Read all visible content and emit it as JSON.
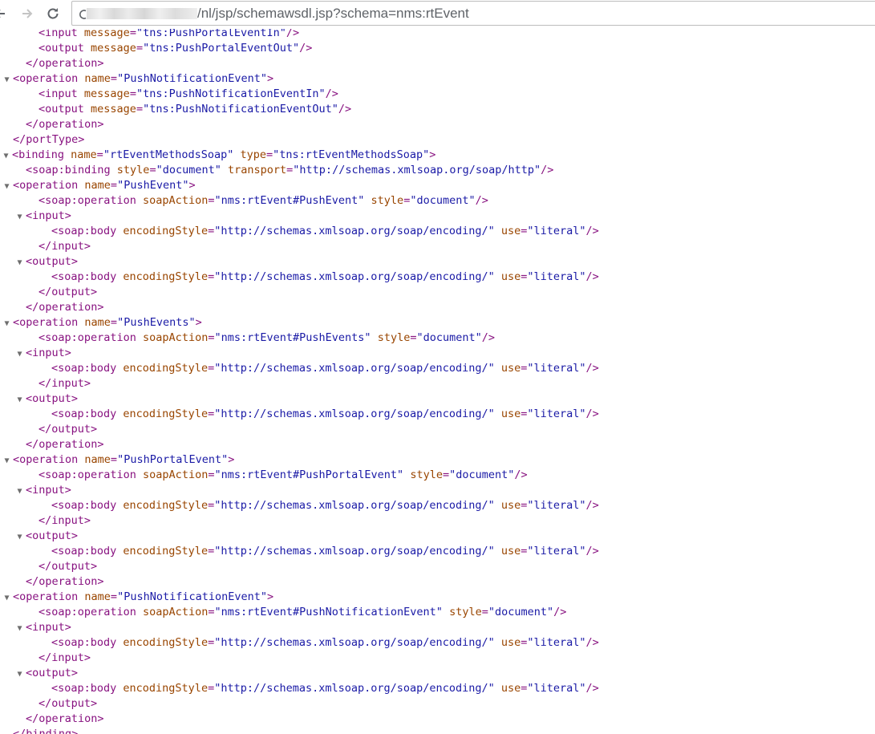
{
  "browser": {
    "url_path": "/nl/jsp/schemawsdl.jsp?schema=nms:rtEvent",
    "icons": {
      "back": "back-arrow-icon",
      "forward": "forward-arrow-icon",
      "reload": "reload-icon",
      "site": "info-icon"
    }
  },
  "colors": {
    "tag": "#881280",
    "attribute": "#994500",
    "value": "#1a1aa6",
    "toggle": "#6e6e6e"
  },
  "xml_lines": [
    {
      "indent": 3,
      "toggle": "",
      "parts": [
        [
          "t",
          "<input "
        ],
        [
          "a",
          "message"
        ],
        [
          "t",
          "="
        ],
        [
          "v",
          "\"tns:PushPortalEventIn\""
        ],
        [
          "t",
          "/>"
        ]
      ]
    },
    {
      "indent": 3,
      "toggle": "",
      "parts": [
        [
          "t",
          "<output "
        ],
        [
          "a",
          "message"
        ],
        [
          "t",
          "="
        ],
        [
          "v",
          "\"tns:PushPortalEventOut\""
        ],
        [
          "t",
          "/>"
        ]
      ]
    },
    {
      "indent": 2,
      "toggle": "",
      "parts": [
        [
          "t",
          "</operation>"
        ]
      ]
    },
    {
      "indent": 1,
      "toggle": "▼",
      "parts": [
        [
          "t",
          "<operation "
        ],
        [
          "a",
          "name"
        ],
        [
          "t",
          "="
        ],
        [
          "v",
          "\"PushNotificationEvent\""
        ],
        [
          "t",
          ">"
        ]
      ]
    },
    {
      "indent": 3,
      "toggle": "",
      "parts": [
        [
          "t",
          "<input "
        ],
        [
          "a",
          "message"
        ],
        [
          "t",
          "="
        ],
        [
          "v",
          "\"tns:PushNotificationEventIn\""
        ],
        [
          "t",
          "/>"
        ]
      ]
    },
    {
      "indent": 3,
      "toggle": "",
      "parts": [
        [
          "t",
          "<output "
        ],
        [
          "a",
          "message"
        ],
        [
          "t",
          "="
        ],
        [
          "v",
          "\"tns:PushNotificationEventOut\""
        ],
        [
          "t",
          "/>"
        ]
      ]
    },
    {
      "indent": 2,
      "toggle": "",
      "parts": [
        [
          "t",
          "</operation>"
        ]
      ]
    },
    {
      "indent": 1,
      "toggle": "",
      "parts": [
        [
          "t",
          "</portType>"
        ]
      ]
    },
    {
      "indent": 0,
      "toggle": "▼",
      "parts": [
        [
          "t",
          "<binding "
        ],
        [
          "a",
          "name"
        ],
        [
          "t",
          "="
        ],
        [
          "v",
          "\"rtEventMethodsSoap\""
        ],
        [
          "t",
          " "
        ],
        [
          "a",
          "type"
        ],
        [
          "t",
          "="
        ],
        [
          "v",
          "\"tns:rtEventMethodsSoap\""
        ],
        [
          "t",
          ">"
        ]
      ]
    },
    {
      "indent": 2,
      "toggle": "",
      "parts": [
        [
          "t",
          "<soap:binding "
        ],
        [
          "a",
          "style"
        ],
        [
          "t",
          "="
        ],
        [
          "v",
          "\"document\""
        ],
        [
          "t",
          " "
        ],
        [
          "a",
          "transport"
        ],
        [
          "t",
          "="
        ],
        [
          "v",
          "\"http://schemas.xmlsoap.org/soap/http\""
        ],
        [
          "t",
          "/>"
        ]
      ]
    },
    {
      "indent": 1,
      "toggle": "▼",
      "parts": [
        [
          "t",
          "<operation "
        ],
        [
          "a",
          "name"
        ],
        [
          "t",
          "="
        ],
        [
          "v",
          "\"PushEvent\""
        ],
        [
          "t",
          ">"
        ]
      ]
    },
    {
      "indent": 3,
      "toggle": "",
      "parts": [
        [
          "t",
          "<soap:operation "
        ],
        [
          "a",
          "soapAction"
        ],
        [
          "t",
          "="
        ],
        [
          "v",
          "\"nms:rtEvent#PushEvent\""
        ],
        [
          "t",
          " "
        ],
        [
          "a",
          "style"
        ],
        [
          "t",
          "="
        ],
        [
          "v",
          "\"document\""
        ],
        [
          "t",
          "/>"
        ]
      ]
    },
    {
      "indent": 2,
      "toggle": "▼",
      "parts": [
        [
          "t",
          "<input>"
        ]
      ]
    },
    {
      "indent": 4,
      "toggle": "",
      "parts": [
        [
          "t",
          "<soap:body "
        ],
        [
          "a",
          "encodingStyle"
        ],
        [
          "t",
          "="
        ],
        [
          "v",
          "\"http://schemas.xmlsoap.org/soap/encoding/\""
        ],
        [
          "t",
          " "
        ],
        [
          "a",
          "use"
        ],
        [
          "t",
          "="
        ],
        [
          "v",
          "\"literal\""
        ],
        [
          "t",
          "/>"
        ]
      ]
    },
    {
      "indent": 3,
      "toggle": "",
      "parts": [
        [
          "t",
          "</input>"
        ]
      ]
    },
    {
      "indent": 2,
      "toggle": "▼",
      "parts": [
        [
          "t",
          "<output>"
        ]
      ]
    },
    {
      "indent": 4,
      "toggle": "",
      "parts": [
        [
          "t",
          "<soap:body "
        ],
        [
          "a",
          "encodingStyle"
        ],
        [
          "t",
          "="
        ],
        [
          "v",
          "\"http://schemas.xmlsoap.org/soap/encoding/\""
        ],
        [
          "t",
          " "
        ],
        [
          "a",
          "use"
        ],
        [
          "t",
          "="
        ],
        [
          "v",
          "\"literal\""
        ],
        [
          "t",
          "/>"
        ]
      ]
    },
    {
      "indent": 3,
      "toggle": "",
      "parts": [
        [
          "t",
          "</output>"
        ]
      ]
    },
    {
      "indent": 2,
      "toggle": "",
      "parts": [
        [
          "t",
          "</operation>"
        ]
      ]
    },
    {
      "indent": 1,
      "toggle": "▼",
      "parts": [
        [
          "t",
          "<operation "
        ],
        [
          "a",
          "name"
        ],
        [
          "t",
          "="
        ],
        [
          "v",
          "\"PushEvents\""
        ],
        [
          "t",
          ">"
        ]
      ]
    },
    {
      "indent": 3,
      "toggle": "",
      "parts": [
        [
          "t",
          "<soap:operation "
        ],
        [
          "a",
          "soapAction"
        ],
        [
          "t",
          "="
        ],
        [
          "v",
          "\"nms:rtEvent#PushEvents\""
        ],
        [
          "t",
          " "
        ],
        [
          "a",
          "style"
        ],
        [
          "t",
          "="
        ],
        [
          "v",
          "\"document\""
        ],
        [
          "t",
          "/>"
        ]
      ]
    },
    {
      "indent": 2,
      "toggle": "▼",
      "parts": [
        [
          "t",
          "<input>"
        ]
      ]
    },
    {
      "indent": 4,
      "toggle": "",
      "parts": [
        [
          "t",
          "<soap:body "
        ],
        [
          "a",
          "encodingStyle"
        ],
        [
          "t",
          "="
        ],
        [
          "v",
          "\"http://schemas.xmlsoap.org/soap/encoding/\""
        ],
        [
          "t",
          " "
        ],
        [
          "a",
          "use"
        ],
        [
          "t",
          "="
        ],
        [
          "v",
          "\"literal\""
        ],
        [
          "t",
          "/>"
        ]
      ]
    },
    {
      "indent": 3,
      "toggle": "",
      "parts": [
        [
          "t",
          "</input>"
        ]
      ]
    },
    {
      "indent": 2,
      "toggle": "▼",
      "parts": [
        [
          "t",
          "<output>"
        ]
      ]
    },
    {
      "indent": 4,
      "toggle": "",
      "parts": [
        [
          "t",
          "<soap:body "
        ],
        [
          "a",
          "encodingStyle"
        ],
        [
          "t",
          "="
        ],
        [
          "v",
          "\"http://schemas.xmlsoap.org/soap/encoding/\""
        ],
        [
          "t",
          " "
        ],
        [
          "a",
          "use"
        ],
        [
          "t",
          "="
        ],
        [
          "v",
          "\"literal\""
        ],
        [
          "t",
          "/>"
        ]
      ]
    },
    {
      "indent": 3,
      "toggle": "",
      "parts": [
        [
          "t",
          "</output>"
        ]
      ]
    },
    {
      "indent": 2,
      "toggle": "",
      "parts": [
        [
          "t",
          "</operation>"
        ]
      ]
    },
    {
      "indent": 1,
      "toggle": "▼",
      "parts": [
        [
          "t",
          "<operation "
        ],
        [
          "a",
          "name"
        ],
        [
          "t",
          "="
        ],
        [
          "v",
          "\"PushPortalEvent\""
        ],
        [
          "t",
          ">"
        ]
      ]
    },
    {
      "indent": 3,
      "toggle": "",
      "parts": [
        [
          "t",
          "<soap:operation "
        ],
        [
          "a",
          "soapAction"
        ],
        [
          "t",
          "="
        ],
        [
          "v",
          "\"nms:rtEvent#PushPortalEvent\""
        ],
        [
          "t",
          " "
        ],
        [
          "a",
          "style"
        ],
        [
          "t",
          "="
        ],
        [
          "v",
          "\"document\""
        ],
        [
          "t",
          "/>"
        ]
      ]
    },
    {
      "indent": 2,
      "toggle": "▼",
      "parts": [
        [
          "t",
          "<input>"
        ]
      ]
    },
    {
      "indent": 4,
      "toggle": "",
      "parts": [
        [
          "t",
          "<soap:body "
        ],
        [
          "a",
          "encodingStyle"
        ],
        [
          "t",
          "="
        ],
        [
          "v",
          "\"http://schemas.xmlsoap.org/soap/encoding/\""
        ],
        [
          "t",
          " "
        ],
        [
          "a",
          "use"
        ],
        [
          "t",
          "="
        ],
        [
          "v",
          "\"literal\""
        ],
        [
          "t",
          "/>"
        ]
      ]
    },
    {
      "indent": 3,
      "toggle": "",
      "parts": [
        [
          "t",
          "</input>"
        ]
      ]
    },
    {
      "indent": 2,
      "toggle": "▼",
      "parts": [
        [
          "t",
          "<output>"
        ]
      ]
    },
    {
      "indent": 4,
      "toggle": "",
      "parts": [
        [
          "t",
          "<soap:body "
        ],
        [
          "a",
          "encodingStyle"
        ],
        [
          "t",
          "="
        ],
        [
          "v",
          "\"http://schemas.xmlsoap.org/soap/encoding/\""
        ],
        [
          "t",
          " "
        ],
        [
          "a",
          "use"
        ],
        [
          "t",
          "="
        ],
        [
          "v",
          "\"literal\""
        ],
        [
          "t",
          "/>"
        ]
      ]
    },
    {
      "indent": 3,
      "toggle": "",
      "parts": [
        [
          "t",
          "</output>"
        ]
      ]
    },
    {
      "indent": 2,
      "toggle": "",
      "parts": [
        [
          "t",
          "</operation>"
        ]
      ]
    },
    {
      "indent": 1,
      "toggle": "▼",
      "parts": [
        [
          "t",
          "<operation "
        ],
        [
          "a",
          "name"
        ],
        [
          "t",
          "="
        ],
        [
          "v",
          "\"PushNotificationEvent\""
        ],
        [
          "t",
          ">"
        ]
      ]
    },
    {
      "indent": 3,
      "toggle": "",
      "parts": [
        [
          "t",
          "<soap:operation "
        ],
        [
          "a",
          "soapAction"
        ],
        [
          "t",
          "="
        ],
        [
          "v",
          "\"nms:rtEvent#PushNotificationEvent\""
        ],
        [
          "t",
          " "
        ],
        [
          "a",
          "style"
        ],
        [
          "t",
          "="
        ],
        [
          "v",
          "\"document\""
        ],
        [
          "t",
          "/>"
        ]
      ]
    },
    {
      "indent": 2,
      "toggle": "▼",
      "parts": [
        [
          "t",
          "<input>"
        ]
      ]
    },
    {
      "indent": 4,
      "toggle": "",
      "parts": [
        [
          "t",
          "<soap:body "
        ],
        [
          "a",
          "encodingStyle"
        ],
        [
          "t",
          "="
        ],
        [
          "v",
          "\"http://schemas.xmlsoap.org/soap/encoding/\""
        ],
        [
          "t",
          " "
        ],
        [
          "a",
          "use"
        ],
        [
          "t",
          "="
        ],
        [
          "v",
          "\"literal\""
        ],
        [
          "t",
          "/>"
        ]
      ]
    },
    {
      "indent": 3,
      "toggle": "",
      "parts": [
        [
          "t",
          "</input>"
        ]
      ]
    },
    {
      "indent": 2,
      "toggle": "▼",
      "parts": [
        [
          "t",
          "<output>"
        ]
      ]
    },
    {
      "indent": 4,
      "toggle": "",
      "parts": [
        [
          "t",
          "<soap:body "
        ],
        [
          "a",
          "encodingStyle"
        ],
        [
          "t",
          "="
        ],
        [
          "v",
          "\"http://schemas.xmlsoap.org/soap/encoding/\""
        ],
        [
          "t",
          " "
        ],
        [
          "a",
          "use"
        ],
        [
          "t",
          "="
        ],
        [
          "v",
          "\"literal\""
        ],
        [
          "t",
          "/>"
        ]
      ]
    },
    {
      "indent": 3,
      "toggle": "",
      "parts": [
        [
          "t",
          "</output>"
        ]
      ]
    },
    {
      "indent": 2,
      "toggle": "",
      "parts": [
        [
          "t",
          "</operation>"
        ]
      ]
    },
    {
      "indent": 1,
      "toggle": "",
      "parts": [
        [
          "t",
          "</binding>"
        ]
      ]
    }
  ]
}
